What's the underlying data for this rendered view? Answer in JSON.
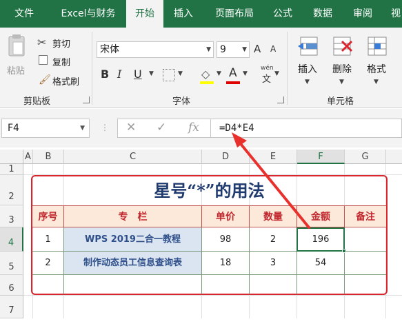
{
  "tabs": [
    "文件",
    "Excel与财务",
    "开始",
    "插入",
    "页面布局",
    "公式",
    "数据",
    "审阅",
    "视"
  ],
  "clipboard": {
    "paste": "粘贴",
    "cut": "剪切",
    "copy": "复制",
    "format_painter": "格式刷",
    "group": "剪贴板"
  },
  "font": {
    "name": "宋体",
    "size": "9",
    "grow": "A",
    "shrink": "A",
    "bold": "B",
    "italic": "I",
    "underline": "U",
    "font_color": "A",
    "phonetic_top": "wén",
    "phonetic_bottom": "文",
    "group": "字体"
  },
  "cells_group": {
    "insert": "插入",
    "delete": "删除",
    "format": "格式",
    "group": "单元格"
  },
  "formula_bar": {
    "name_box": "F4",
    "cancel": "✕",
    "enter": "✓",
    "fx": "fx",
    "formula": "=D4*E4"
  },
  "columns": [
    "A",
    "B",
    "C",
    "D",
    "E",
    "F",
    "G"
  ],
  "rows": [
    "1",
    "2",
    "3",
    "4",
    "5",
    "6",
    "7"
  ],
  "sheet": {
    "title": "星号“*”的用法",
    "headers": [
      "序号",
      "专　栏",
      "单价",
      "数量",
      "金额",
      "备注"
    ],
    "rows": [
      [
        "1",
        "WPS 2019二合一教程",
        "98",
        "2",
        "196",
        ""
      ],
      [
        "2",
        "制作动态员工信息查询表",
        "18",
        "3",
        "54",
        ""
      ]
    ]
  },
  "colors": {
    "brand": "#217346",
    "accent_red": "#d9262e",
    "title_blue": "#1f3a6e",
    "header_fill": "#fde9d9",
    "project_fill": "#dbe5f1"
  }
}
